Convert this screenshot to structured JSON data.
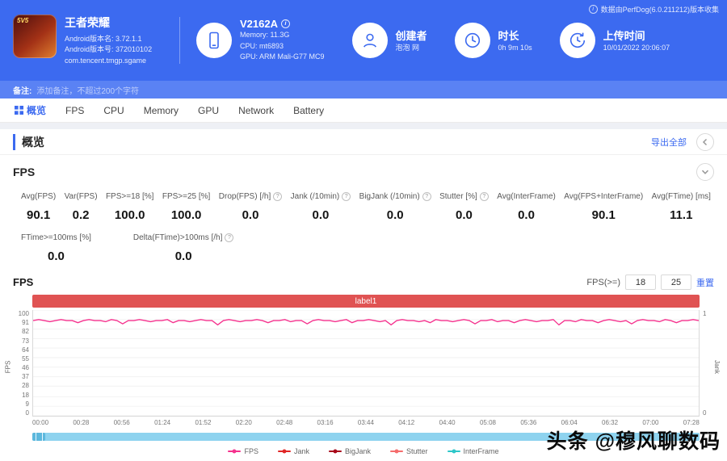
{
  "header": {
    "app": {
      "title": "王者荣耀",
      "badge": "5V5",
      "meta1": "Android版本名: 3.72.1.1",
      "meta2": "Android版本号: 372010102",
      "meta3": "com.tencent.tmgp.sgame"
    },
    "device": {
      "name": "V2162A",
      "memory": "Memory: 11.3G",
      "cpu": "CPU: mt6893",
      "gpu": "GPU: ARM Mali-G77 MC9"
    },
    "creator": {
      "label": "创建者",
      "value": "泡泡 网"
    },
    "duration": {
      "label": "时长",
      "value": "0h 9m 10s"
    },
    "upload": {
      "label": "上传时间",
      "value": "10/01/2022 20:06:07"
    },
    "version_note": "数据由PerfDog(6.0.211212)版本收集"
  },
  "note_bar": {
    "label": "备注:",
    "text": "添加备注，不超过200个字符"
  },
  "tabs": [
    {
      "label": "概览",
      "active": true
    },
    {
      "label": "FPS"
    },
    {
      "label": "CPU"
    },
    {
      "label": "Memory"
    },
    {
      "label": "GPU"
    },
    {
      "label": "Network"
    },
    {
      "label": "Battery"
    }
  ],
  "overview": {
    "title": "概览",
    "export_label": "导出全部"
  },
  "fps_section": {
    "title": "FPS",
    "metrics": [
      {
        "label": "Avg(FPS)",
        "value": "90.1",
        "info": false
      },
      {
        "label": "Var(FPS)",
        "value": "0.2",
        "info": false
      },
      {
        "label": "FPS>=18 [%]",
        "value": "100.0",
        "info": false
      },
      {
        "label": "FPS>=25 [%]",
        "value": "100.0",
        "info": false
      },
      {
        "label": "Drop(FPS) [/h]",
        "value": "0.0",
        "info": true
      },
      {
        "label": "Jank (/10min)",
        "value": "0.0",
        "info": true
      },
      {
        "label": "BigJank (/10min)",
        "value": "0.0",
        "info": true
      },
      {
        "label": "Stutter [%]",
        "value": "0.0",
        "info": true
      },
      {
        "label": "Avg(InterFrame)",
        "value": "0.0",
        "info": false
      },
      {
        "label": "Avg(FPS+InterFrame)",
        "value": "90.1",
        "info": false
      },
      {
        "label": "Avg(FTime) [ms]",
        "value": "11.1",
        "info": false
      }
    ],
    "metrics_row2": [
      {
        "label": "FTime>=100ms [%]",
        "value": "0.0",
        "info": false
      },
      {
        "label": "Delta(FTime)>100ms [/h]",
        "value": "0.0",
        "info": true
      }
    ],
    "chart_header": {
      "left_label": "FPS",
      "threshold_label": "FPS(>=)",
      "threshold1": "18",
      "threshold2": "25",
      "reset_label": "重置"
    }
  },
  "chart_data": {
    "type": "line",
    "banner": "label1",
    "ylabel_left": "FPS",
    "ylabel_right": "Jank",
    "ylim_left": [
      0,
      100
    ],
    "ylim_right": [
      0,
      1
    ],
    "grid": true,
    "legend_position": "bottom",
    "y_ticks_left": [
      100,
      91,
      82,
      73,
      64,
      55,
      46,
      37,
      28,
      18,
      9,
      0
    ],
    "y_ticks_right": [
      1,
      0
    ],
    "x_ticks": [
      "00:00",
      "00:28",
      "00:56",
      "01:24",
      "01:52",
      "02:20",
      "02:48",
      "03:16",
      "03:44",
      "04:12",
      "04:40",
      "05:08",
      "05:36",
      "06:04",
      "06:32",
      "07:00",
      "07:28"
    ],
    "series": [
      {
        "name": "FPS",
        "color": "#f5318d",
        "avg": 90.1,
        "values": [
          90,
          91,
          90,
          89,
          90,
          91,
          90,
          90,
          88,
          90,
          91,
          90,
          90,
          89,
          91,
          90,
          87,
          90,
          90,
          91,
          90,
          89,
          90,
          90,
          91,
          88,
          90,
          90,
          89,
          90,
          91,
          90,
          90,
          86,
          90,
          91,
          90,
          89,
          90,
          90,
          91,
          90,
          88,
          90,
          90,
          91,
          89,
          90,
          90,
          87,
          90,
          91,
          90,
          90,
          89,
          90,
          91,
          88,
          90,
          90,
          91,
          90,
          89,
          90,
          86,
          90,
          91,
          90,
          90,
          89,
          90,
          88,
          91,
          90,
          90,
          89,
          90,
          91,
          90,
          87,
          90,
          90,
          91,
          89,
          90,
          90,
          88,
          90,
          91,
          90,
          89,
          90,
          90,
          91,
          86,
          90,
          90,
          89,
          91,
          90,
          90,
          88,
          90,
          91,
          90,
          89,
          90,
          87,
          90,
          91,
          90,
          90,
          89,
          91,
          90,
          88,
          90,
          90,
          91,
          90
        ]
      }
    ],
    "legend": [
      {
        "label": "FPS",
        "color": "#f5318d"
      },
      {
        "label": "Jank",
        "color": "#e02626"
      },
      {
        "label": "BigJank",
        "color": "#a8071a"
      },
      {
        "label": "Stutter",
        "color": "#f56c6c"
      },
      {
        "label": "InterFrame",
        "color": "#2ec7c9"
      }
    ]
  },
  "watermark": "头条 @穆风聊数码"
}
